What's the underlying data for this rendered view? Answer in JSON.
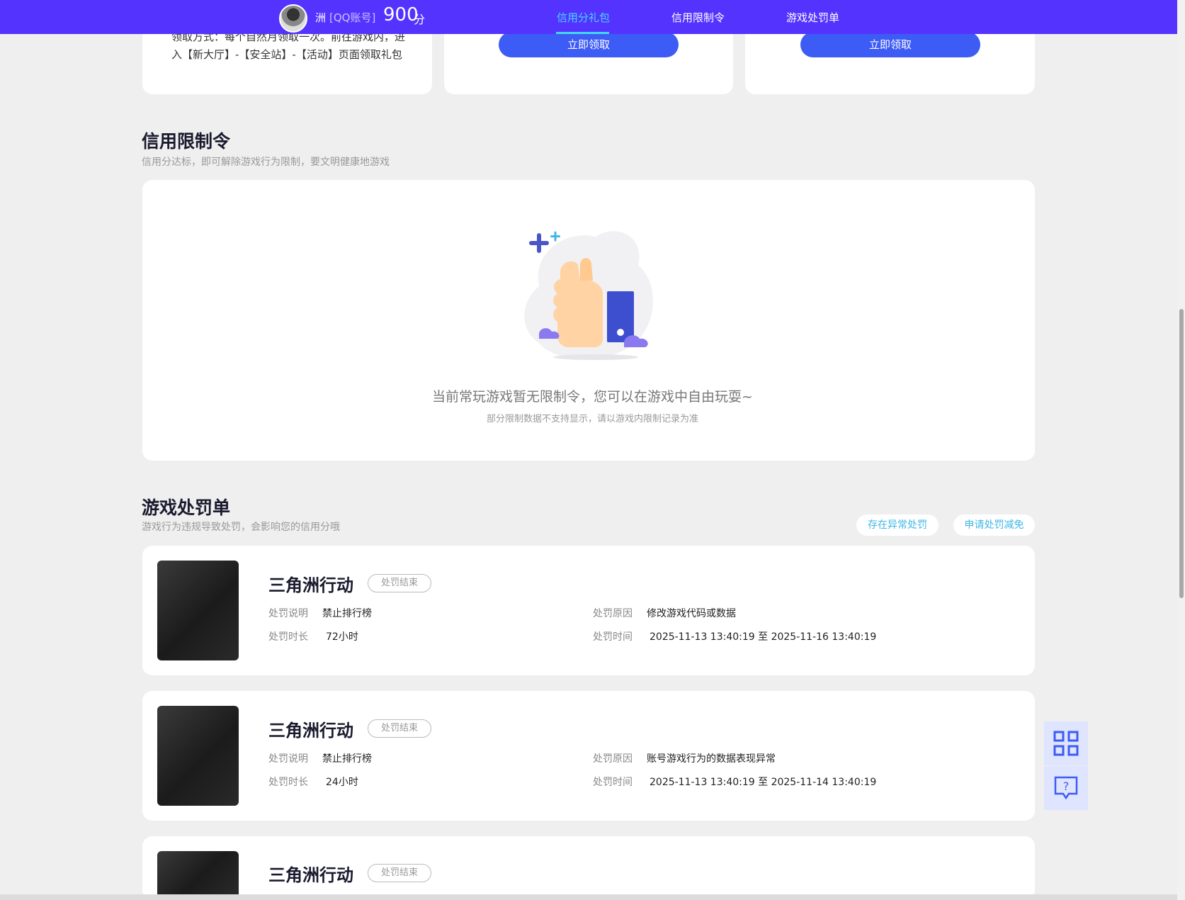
{
  "header": {
    "user_name": "洲",
    "account_type": "[QQ账号]",
    "score": "900",
    "score_unit": "分",
    "tabs": [
      {
        "label": "信用分礼包",
        "active": true
      },
      {
        "label": "信用限制令",
        "active": false
      },
      {
        "label": "游戏处罚单",
        "active": false
      }
    ]
  },
  "gift_cards": {
    "card1_desc": "领取方式：每个自然月领取一次。前往游戏内，进入【新大厅】-【安全站】-【活动】页面领取礼包",
    "claim_label": "立即领取"
  },
  "restriction": {
    "title": "信用限制令",
    "subtitle": "信用分达标，即可解除游戏行为限制，要文明健康地游戏",
    "empty_main": "当前常玩游戏暂无限制令，您可以在游戏中自由玩耍~",
    "empty_note": "部分限制数据不支持显示，请以游戏内限制记录为准"
  },
  "penalty": {
    "title": "游戏处罚单",
    "subtitle": "游戏行为违规导致处罚，会影响您的信用分哦",
    "btn_abnormal": "存在异常处罚",
    "btn_reduce": "申请处罚减免",
    "labels": {
      "desc": "处罚说明",
      "duration": "处罚时长",
      "reason": "处罚原因",
      "time": "处罚时间"
    },
    "records": [
      {
        "game": "三角洲行动",
        "status": "处罚结束",
        "desc": "禁止排行榜",
        "duration": "72小时",
        "reason": "修改游戏代码或数据",
        "time": "2025-11-13 13:40:19 至 2025-11-16 13:40:19"
      },
      {
        "game": "三角洲行动",
        "status": "处罚结束",
        "desc": "禁止排行榜",
        "duration": "24小时",
        "reason": "账号游戏行为的数据表现异常",
        "time": "2025-11-13 13:40:19 至 2025-11-14 13:40:19"
      },
      {
        "game": "三角洲行动",
        "status": "处罚结束"
      }
    ]
  },
  "side_tools": {
    "qr_icon": "qr-code-icon",
    "help_icon": "help-chat-icon"
  },
  "colors": {
    "header_bg": "#5533ff",
    "active_tab": "#43d7ff",
    "button_blue": "#3d5bf5",
    "page_bg": "#efefef"
  }
}
